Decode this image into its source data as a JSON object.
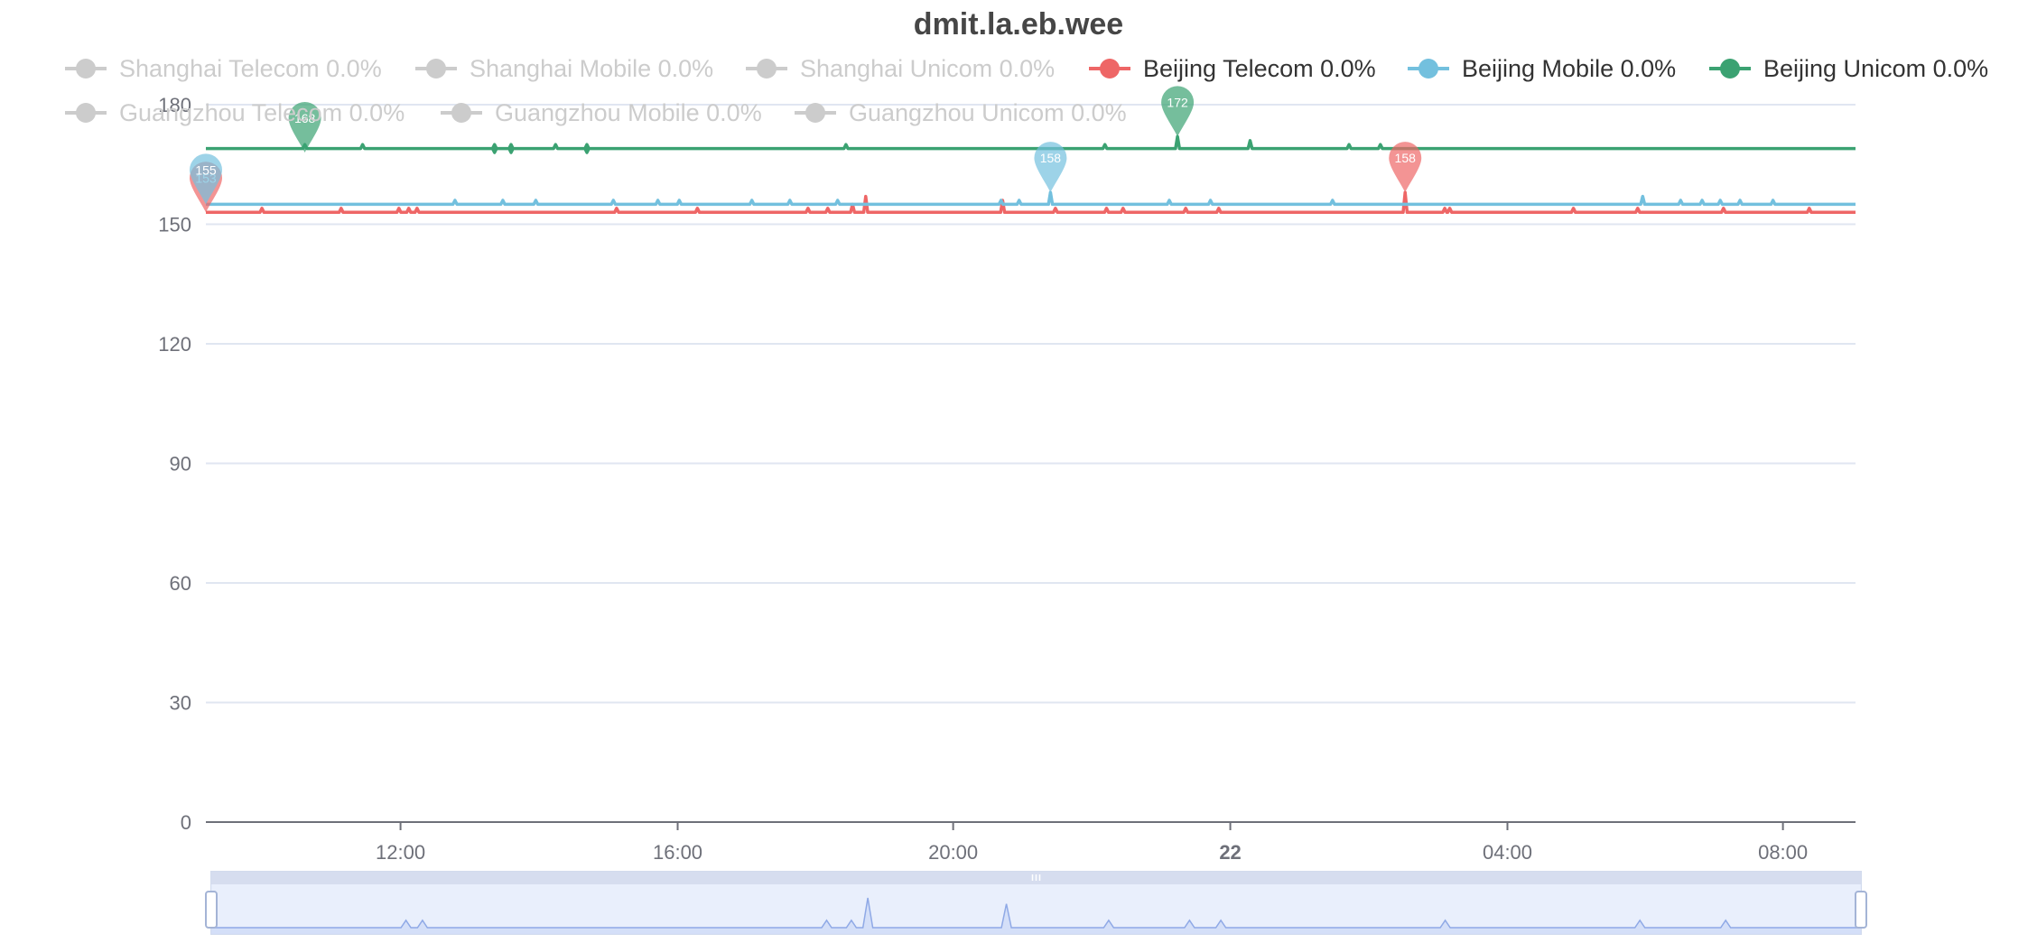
{
  "chart_data": {
    "type": "line",
    "title": "dmit.la.eb.wee",
    "xlabel": "",
    "ylabel": "",
    "ylim": [
      0,
      180
    ],
    "y_ticks": [
      "0",
      "30",
      "60",
      "90",
      "120",
      "150",
      "180"
    ],
    "x_ticks": [
      "12:00",
      "16:00",
      "20:00",
      "22",
      "04:00",
      "08:00"
    ],
    "grid": true,
    "legend_position": "top",
    "series": [
      {
        "name": "Shanghai Telecom 0.0%",
        "enabled": false,
        "color": "#cccccc",
        "values": []
      },
      {
        "name": "Shanghai Mobile 0.0%",
        "enabled": false,
        "color": "#cccccc",
        "values": []
      },
      {
        "name": "Shanghai Unicom 0.0%",
        "enabled": false,
        "color": "#cccccc",
        "values": []
      },
      {
        "name": "Beijing Telecom 0.0%",
        "enabled": true,
        "color": "#ee6666",
        "baseline": 153,
        "spikes": [
          [
            0.034,
            154
          ],
          [
            0.082,
            154
          ],
          [
            0.117,
            154
          ],
          [
            0.123,
            154
          ],
          [
            0.128,
            154
          ],
          [
            0.249,
            154
          ],
          [
            0.298,
            154
          ],
          [
            0.365,
            154
          ],
          [
            0.377,
            154
          ],
          [
            0.392,
            155
          ],
          [
            0.4,
            157
          ],
          [
            0.483,
            156
          ],
          [
            0.515,
            154
          ],
          [
            0.546,
            154
          ],
          [
            0.556,
            154
          ],
          [
            0.594,
            154
          ],
          [
            0.614,
            154
          ],
          [
            0.727,
            158
          ],
          [
            0.751,
            154
          ],
          [
            0.754,
            154
          ],
          [
            0.829,
            154
          ],
          [
            0.868,
            154
          ],
          [
            0.92,
            154
          ],
          [
            0.972,
            154
          ]
        ],
        "markers": [
          {
            "label": "153",
            "pos": 0.0
          },
          {
            "label": "158",
            "pos": 0.727
          }
        ]
      },
      {
        "name": "Beijing Mobile 0.0%",
        "enabled": true,
        "color": "#73c0de",
        "baseline": 155,
        "spikes": [
          [
            0.151,
            156
          ],
          [
            0.18,
            156
          ],
          [
            0.2,
            156
          ],
          [
            0.247,
            156
          ],
          [
            0.274,
            156
          ],
          [
            0.287,
            156
          ],
          [
            0.331,
            156
          ],
          [
            0.354,
            156
          ],
          [
            0.383,
            156
          ],
          [
            0.482,
            156
          ],
          [
            0.493,
            156
          ],
          [
            0.512,
            158
          ],
          [
            0.584,
            156
          ],
          [
            0.609,
            156
          ],
          [
            0.683,
            156
          ],
          [
            0.871,
            157
          ],
          [
            0.894,
            156
          ],
          [
            0.907,
            156
          ],
          [
            0.918,
            156
          ],
          [
            0.93,
            156
          ],
          [
            0.95,
            156
          ]
        ],
        "markers": [
          {
            "label": "155",
            "pos": 0.0
          },
          {
            "label": "158",
            "pos": 0.512
          }
        ]
      },
      {
        "name": "Beijing Unicom 0.0%",
        "enabled": true,
        "color": "#3ba272",
        "baseline": 169,
        "spikes": [
          [
            0.06,
            170
          ],
          [
            0.095,
            170
          ],
          [
            0.175,
            170
          ],
          [
            0.185,
            170
          ],
          [
            0.212,
            170
          ],
          [
            0.231,
            170
          ],
          [
            0.388,
            170
          ],
          [
            0.545,
            170
          ],
          [
            0.589,
            172
          ],
          [
            0.633,
            171
          ],
          [
            0.693,
            170
          ],
          [
            0.712,
            170
          ]
        ],
        "dips": [
          [
            0.175,
            168
          ],
          [
            0.185,
            168
          ],
          [
            0.231,
            168
          ]
        ],
        "markers": [
          {
            "label": "168",
            "pos": 0.06
          },
          {
            "label": "172",
            "pos": 0.589
          }
        ]
      },
      {
        "name": "Guangzhou Telecom 0.0%",
        "enabled": false,
        "color": "#cccccc",
        "values": []
      },
      {
        "name": "Guangzhou Mobile 0.0%",
        "enabled": false,
        "color": "#cccccc",
        "values": []
      },
      {
        "name": "Guangzhou Unicom 0.0%",
        "enabled": false,
        "color": "#cccccc",
        "values": []
      }
    ],
    "datazoom": {
      "start": 0,
      "end": 100,
      "preview_peaks": [
        [
          0.118,
          0.25
        ],
        [
          0.128,
          0.25
        ],
        [
          0.373,
          0.25
        ],
        [
          0.388,
          0.25
        ],
        [
          0.398,
          1.0
        ],
        [
          0.482,
          0.8
        ],
        [
          0.544,
          0.25
        ],
        [
          0.593,
          0.25
        ],
        [
          0.612,
          0.25
        ],
        [
          0.748,
          0.25
        ],
        [
          0.866,
          0.25
        ],
        [
          0.918,
          0.25
        ]
      ]
    }
  }
}
